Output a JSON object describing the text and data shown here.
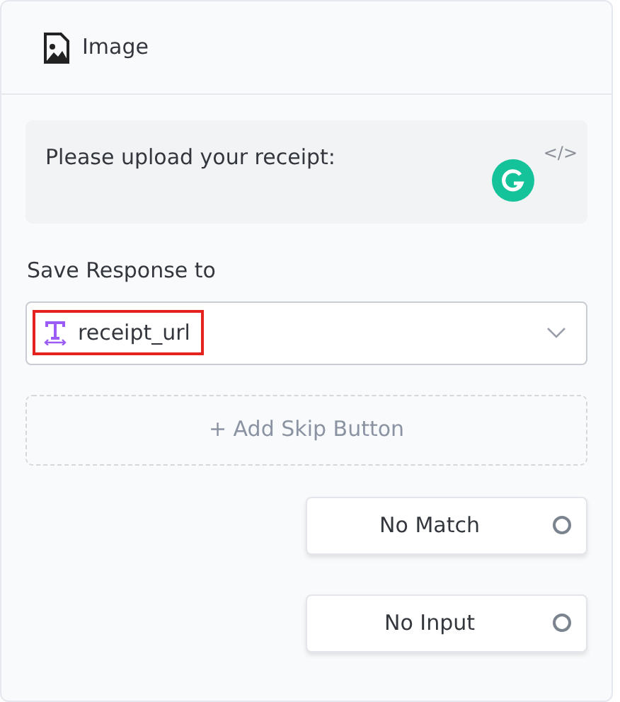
{
  "header": {
    "title": "Image"
  },
  "prompt": {
    "text": "Please upload your receipt:",
    "code_toggle": "</>"
  },
  "save_response": {
    "label": "Save Response to",
    "variable": "receipt_url",
    "highlighted": true
  },
  "skip_button": {
    "label": "+ Add Skip Button"
  },
  "paths": [
    {
      "label": "No Match"
    },
    {
      "label": "No Input"
    }
  ]
}
